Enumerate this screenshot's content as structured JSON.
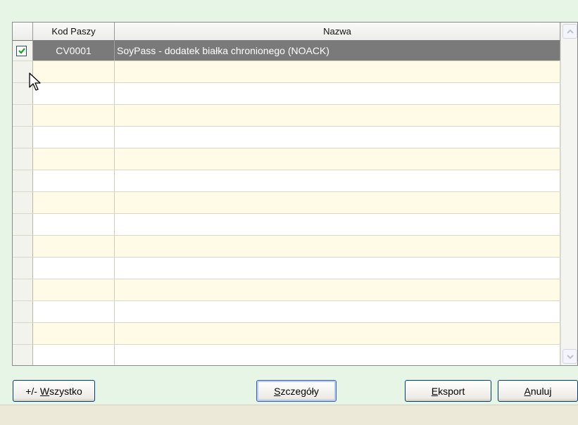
{
  "grid": {
    "columns": [
      {
        "label": ""
      },
      {
        "label": "Kod Paszy"
      },
      {
        "label": "Nazwa"
      }
    ],
    "rows": [
      {
        "checked": true,
        "code": "CV0001",
        "name": "SoyPass - dodatek białka chronionego (NOACK)"
      }
    ],
    "empty_rows": 14
  },
  "buttons": {
    "all": {
      "prefix": "+/- ",
      "mnemonic": "W",
      "rest": "szystko"
    },
    "details": {
      "prefix": "",
      "mnemonic": "S",
      "rest": "zczegóły"
    },
    "export": {
      "prefix": "",
      "mnemonic": "E",
      "rest": "ksport"
    },
    "cancel": {
      "prefix": "",
      "mnemonic": "A",
      "rest": "nuluj"
    }
  },
  "colors": {
    "window_background": "#e6f5e6",
    "selected_row": "#7a7a7a",
    "alternate_row": "#fffbe6",
    "checkbox_check": "#21a121"
  },
  "icons": {
    "checkbox": "check-icon",
    "scroll_up": "chevron-up-icon",
    "scroll_down": "chevron-down-icon",
    "cursor": "mouse-pointer-icon"
  }
}
